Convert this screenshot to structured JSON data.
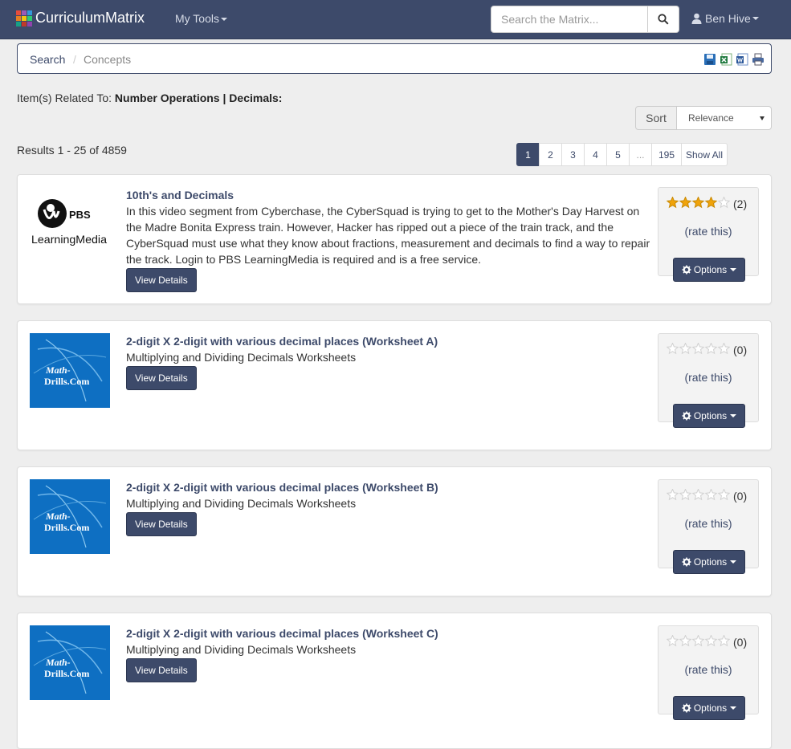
{
  "nav": {
    "brand": "CurriculumMatrix",
    "tools_label": "My Tools",
    "search_placeholder": "Search the Matrix...",
    "user_name": "Ben Hive"
  },
  "breadcrumb": {
    "items": [
      "Search",
      "Concepts"
    ],
    "separator": "/"
  },
  "related": {
    "prefix": "Item(s) Related To:",
    "topic": "Number Operations | Decimals:"
  },
  "sort": {
    "label": "Sort",
    "selected": "Relevance"
  },
  "results_summary": "Results 1 - 25 of 4859",
  "pagination": [
    "1",
    "2",
    "3",
    "4",
    "5",
    "...",
    "195",
    "Show All"
  ],
  "pagination_active": "1",
  "results": [
    {
      "title": "10th's and Decimals",
      "description": "In this video segment from Cyberchase, the CyberSquad is trying to get to the Mother's Day Harvest on the Madre Bonita Express train. However, Hacker has ripped out a piece of the train track, and the CyberSquad must use what they know about fractions, measurement and decimals to find a way to repair the track. Login to PBS LearningMedia is required and is a free service.",
      "logo": "PBS LearningMedia",
      "logo_lines": [
        "PBS",
        "LearningMedia"
      ],
      "rating_stars": 4,
      "rating_count": "(2)",
      "rate_label": "(rate this)",
      "view_label": "View Details",
      "options_label": "Options"
    },
    {
      "title": "2-digit X 2-digit with various decimal places (Worksheet A)",
      "description": "Multiplying and Dividing Decimals Worksheets",
      "logo": "Math-Drills.Com",
      "logo_lines": [
        "Math-",
        "Drills.Com"
      ],
      "rating_stars": 0,
      "rating_count": "(0)",
      "rate_label": "(rate this)",
      "view_label": "View Details",
      "options_label": "Options"
    },
    {
      "title": "2-digit X 2-digit with various decimal places (Worksheet B)",
      "description": "Multiplying and Dividing Decimals Worksheets",
      "logo": "Math-Drills.Com",
      "logo_lines": [
        "Math-",
        "Drills.Com"
      ],
      "rating_stars": 0,
      "rating_count": "(0)",
      "rate_label": "(rate this)",
      "view_label": "View Details",
      "options_label": "Options"
    },
    {
      "title": "2-digit X 2-digit with various decimal places (Worksheet C)",
      "description": "Multiplying and Dividing Decimals Worksheets",
      "logo": "Math-Drills.Com",
      "logo_lines": [
        "Math-",
        "Drills.Com"
      ],
      "rating_stars": 0,
      "rating_count": "(0)",
      "rate_label": "(rate this)",
      "view_label": "View Details",
      "options_label": "Options"
    }
  ],
  "colors": {
    "navbar": "#3d4a6a",
    "accent": "#3d4a6a",
    "star_filled": "#f0a30a",
    "star_empty": "#d0d0d0",
    "mathdrills_bg": "#0e6fc2"
  }
}
